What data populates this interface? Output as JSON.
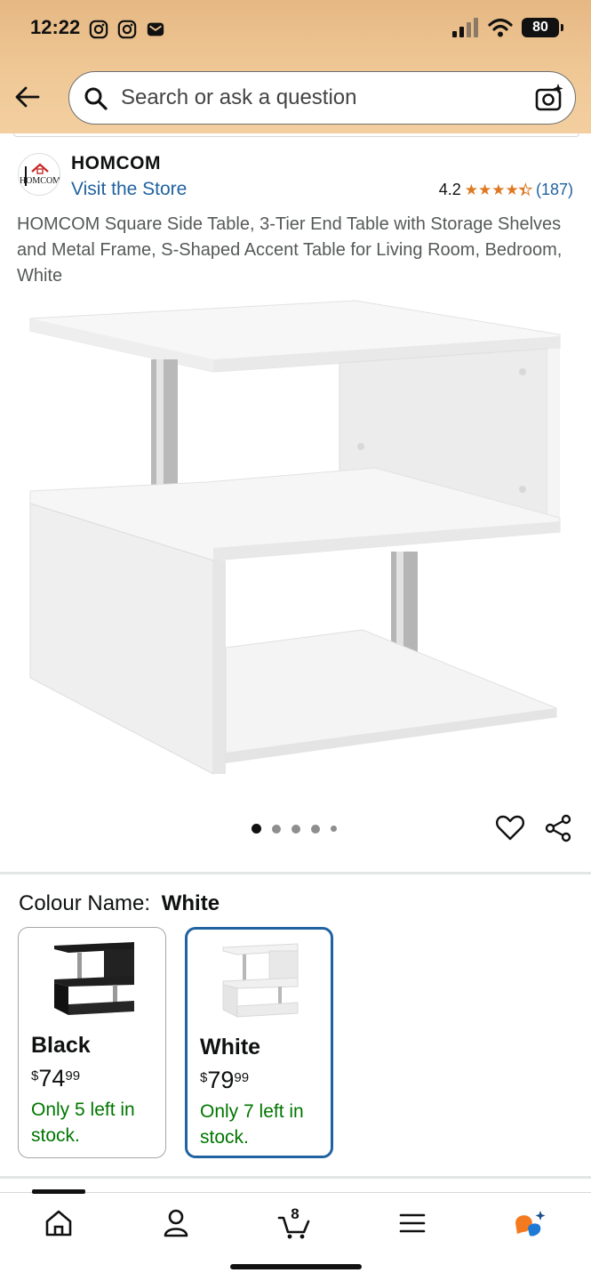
{
  "status_bar": {
    "time": "12:22",
    "battery": "80"
  },
  "search": {
    "placeholder": "Search or ask a question"
  },
  "brand": {
    "name": "HOMCOM",
    "store_link": "Visit the Store",
    "rating": "4.2",
    "stars": 4.2,
    "review_count": "(187)",
    "star_color": "#de7921"
  },
  "product": {
    "title": "HOMCOM Square Side Table, 3-Tier End Table with Storage Shelves and Metal Frame, S-Shaped Accent Table for Living Room, Bedroom, White",
    "image_count": 5,
    "active_image": 1
  },
  "variant": {
    "label": "Colour Name:",
    "selected": "White",
    "options": [
      {
        "name": "Black",
        "currency": "$",
        "whole": "74",
        "fraction": "99",
        "stock": "Only 5 left in stock.",
        "selected": false
      },
      {
        "name": "White",
        "currency": "$",
        "whole": "79",
        "fraction": "99",
        "stock": "Only 7 left in stock.",
        "selected": true
      }
    ]
  },
  "nav": {
    "items": [
      "home-icon",
      "account-icon",
      "cart-icon",
      "menu-icon",
      "rufus-icon"
    ],
    "cart_count": "8"
  },
  "colors": {
    "link": "#2162a1",
    "stock_green": "#007600",
    "selected_border": "#2162a1"
  }
}
